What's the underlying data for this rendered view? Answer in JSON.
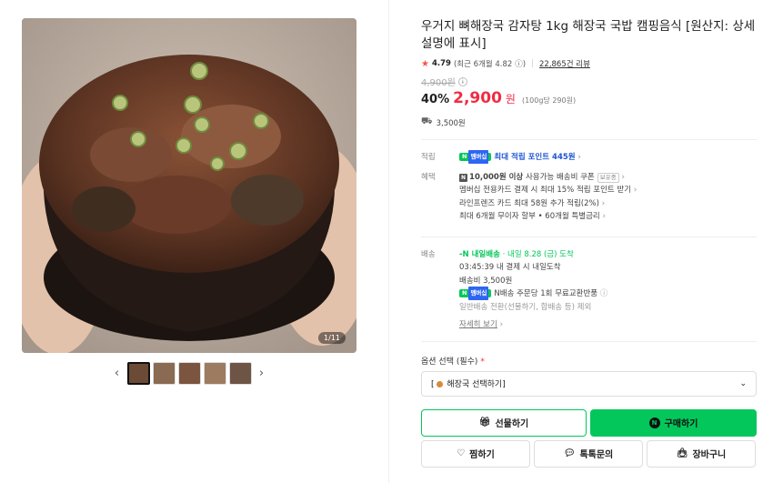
{
  "gallery": {
    "counter": "1/11",
    "thumbs_count": 5
  },
  "product": {
    "title": "우거지 뼈해장국 감자탕 1kg 해장국 국밥 캠핑음식 [원산지: 상세설명에 표시]",
    "rating": "4.79",
    "rating_recent": "(최근 6개월 4.82",
    "rating_info": "ⓘ)",
    "reviews": "22,865건 리뷰",
    "original_price": "4,900원",
    "discount": "40%",
    "price": "2,900",
    "won": "원",
    "unit_price": "(100g당 290원)",
    "shipping_fee": "3,500원"
  },
  "benefits": {
    "point_label": "적립",
    "point_text": "최대 적립 포인트 445원",
    "benefit_label": "혜택",
    "coupon_amount": "10,000원 이상",
    "coupon_text": " 사용가능 배송비 쿠폰",
    "coupon_badge": "보유중",
    "line2": "멤버십 전용카드 결제 시 최대 15% 적립 포인트 받기",
    "line3": "라인프렌즈 카드 최대 58원 추가 적립(2%)",
    "line4": "최대 6개월 무이자 할부 • 60개월 특별금리"
  },
  "delivery": {
    "label": "배송",
    "ndelivery": "내일배송",
    "arrival": "· 내일 8.28 (금) 도착",
    "deadline": "03:45:39  내 결제 시 내일도착",
    "fee": "배송비 3,500원",
    "exchange": "N배송 주문당 1회 무료교환반품",
    "note": "일반배송 전환(선물하기, 합배송 등) 제외",
    "more": "자세히 보기"
  },
  "options": {
    "label": "옵션 선택 (필수)",
    "required_mark": "*",
    "select_value": "해장국 선택하기]",
    "select_prefix": "["
  },
  "buttons": {
    "gift": "선물하기",
    "buy": "구매하기",
    "wish": "찜하기",
    "talk": "톡톡문의",
    "cart": "장바구니"
  },
  "colors": {
    "accent_green": "#03c75a",
    "price_red": "#f02c43",
    "link_blue": "#1e55d6"
  }
}
